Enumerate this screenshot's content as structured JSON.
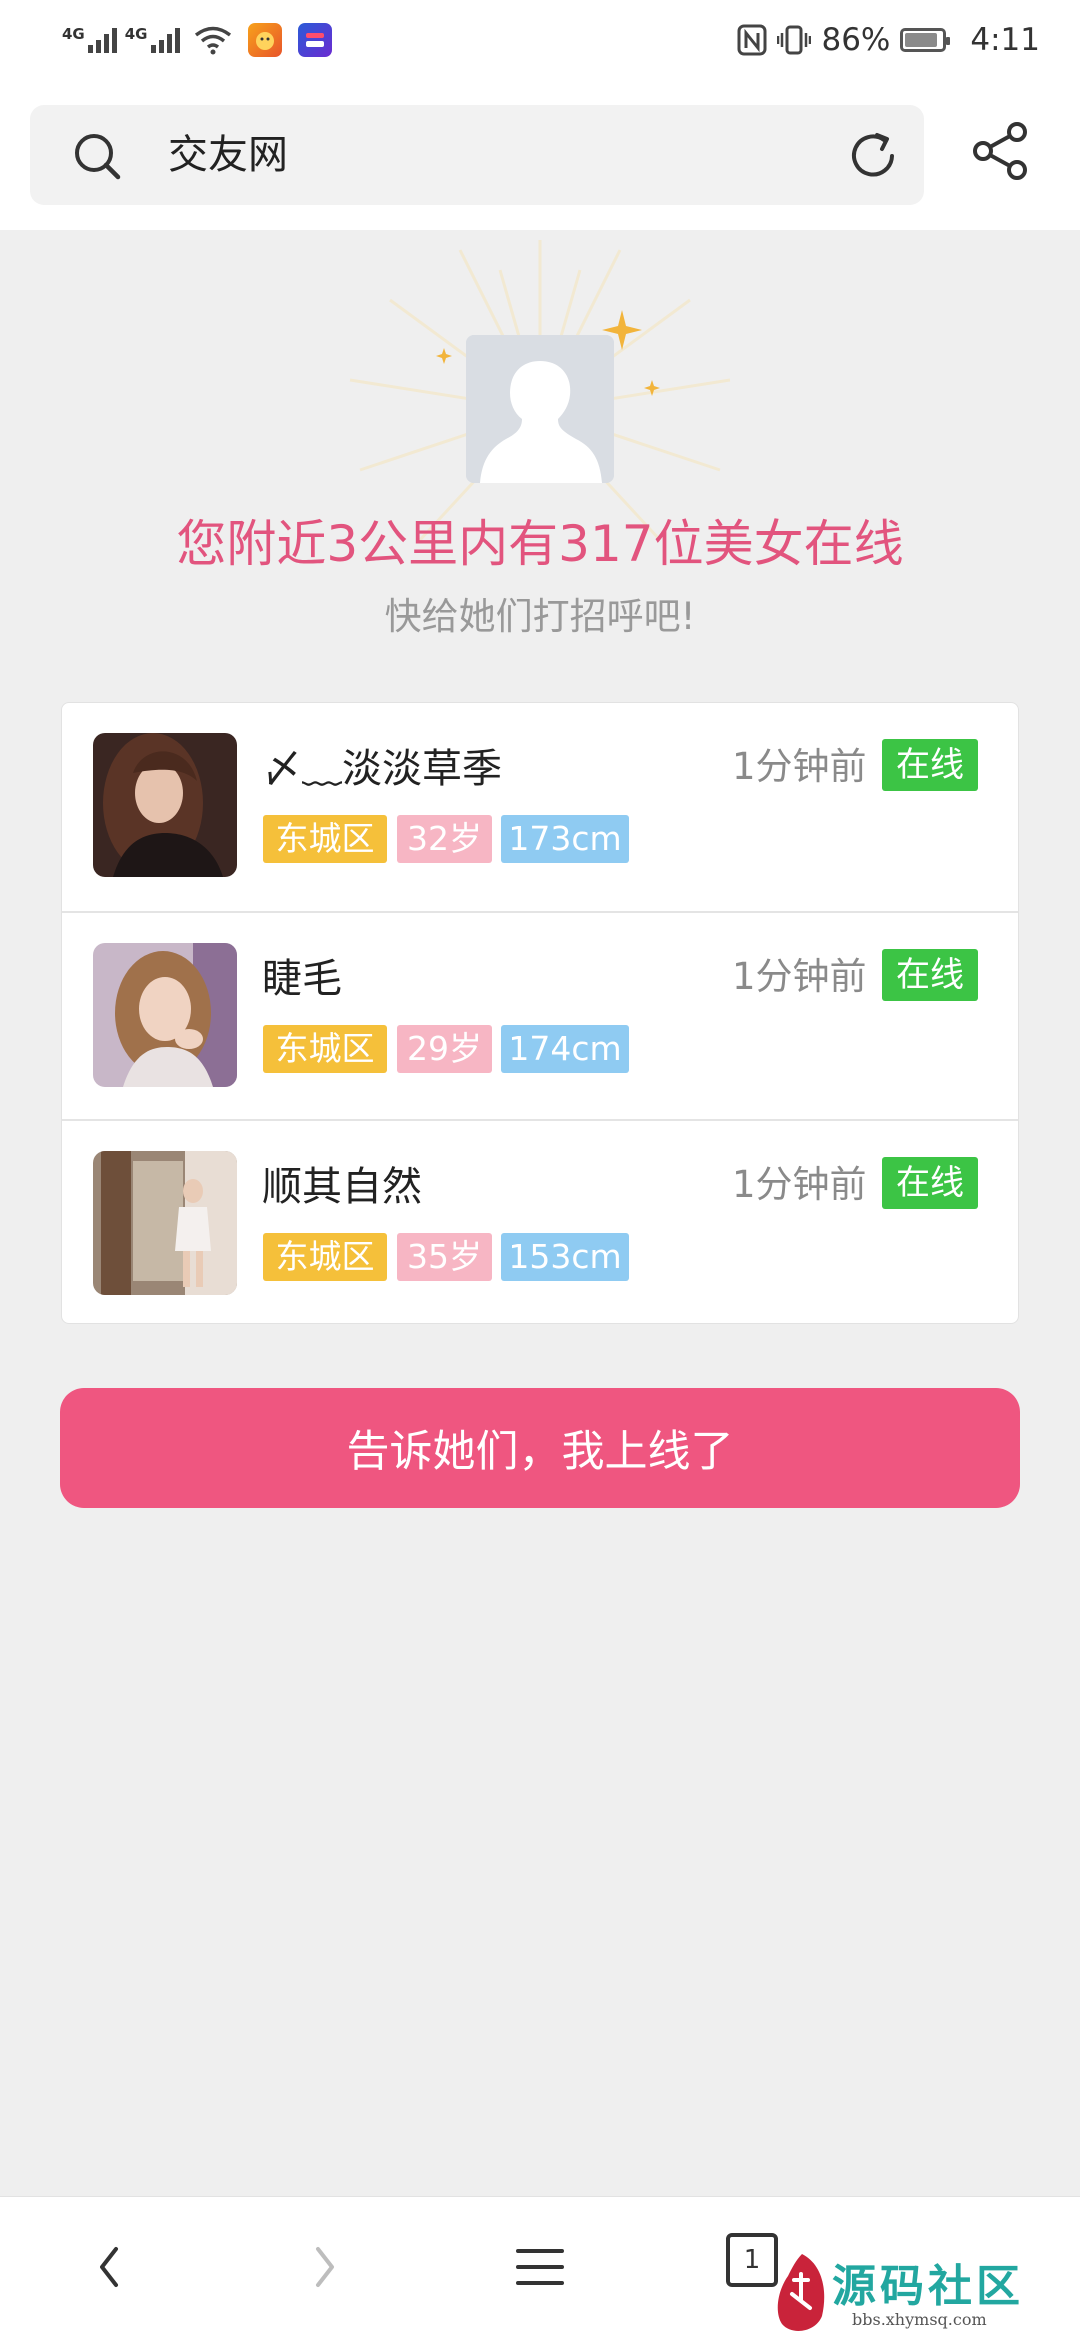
{
  "status_bar": {
    "network_1": "4G",
    "network_2": "4G",
    "nfc": "N",
    "battery": "86%",
    "time": "4:11"
  },
  "top_bar": {
    "search_text": "交友网",
    "icons": [
      "search-icon",
      "reload-icon",
      "share-icon"
    ]
  },
  "hero": {
    "headline": "您附近3公里内有317位美女在线",
    "subline": "快给她们打招呼吧!"
  },
  "users": [
    {
      "name": "〆﹏淡淡草季",
      "time": "1分钟前",
      "status": "在线",
      "district": "东城区",
      "age": "32岁",
      "height": "173cm"
    },
    {
      "name": "睫毛",
      "time": "1分钟前",
      "status": "在线",
      "district": "东城区",
      "age": "29岁",
      "height": "174cm"
    },
    {
      "name": "顺其自然",
      "time": "1分钟前",
      "status": "在线",
      "district": "东城区",
      "age": "35岁",
      "height": "153cm"
    }
  ],
  "cta": {
    "label": "告诉她们，我上线了"
  },
  "bottom_nav": {
    "tab_count": "1",
    "icons": [
      "back-arrow-icon",
      "forward-arrow-icon",
      "menu-icon",
      "tabs-icon"
    ]
  },
  "watermark": {
    "title": "源码社区",
    "url": "bbs.xhymsq.com"
  },
  "colors": {
    "accent_pink": "#ef5680",
    "headline_pink": "#e2547e",
    "online_green": "#3cc445",
    "district_yellow": "#f5c03a",
    "age_pink": "#f7b6c4",
    "height_blue": "#8fcbf2"
  }
}
